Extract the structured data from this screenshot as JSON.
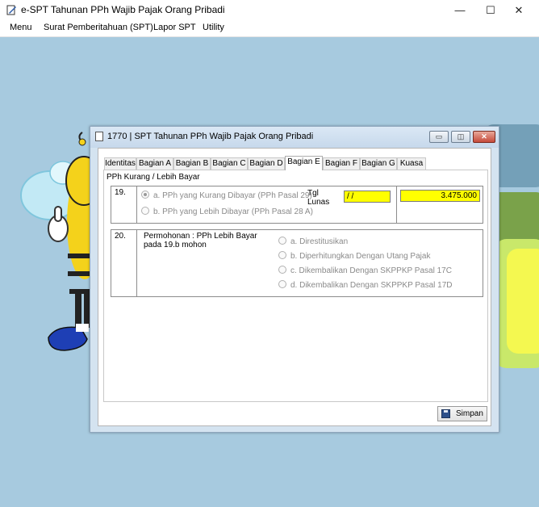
{
  "window": {
    "title": "e-SPT Tahunan PPh Wajib Pajak Orang Pribadi",
    "minimize_symbol": "—",
    "maximize_symbol": "☐",
    "close_symbol": "✕"
  },
  "menubar": {
    "items": [
      "Menu",
      "Surat Pemberitahuan (SPT)",
      "Lapor SPT",
      "Utility"
    ]
  },
  "dialog": {
    "title": "1770 | SPT Tahunan PPh Wajib Pajak Orang Pribadi",
    "minimize_symbol": "▭",
    "restore_symbol": "◫",
    "close_symbol": "✕",
    "tabs": [
      "Identitas",
      "Bagian A",
      "Bagian B",
      "Bagian C",
      "Bagian D",
      "Bagian E",
      "Bagian F",
      "Bagian G",
      "Kuasa"
    ],
    "active_tab": "Bagian E",
    "section_label": "PPh Kurang / Lebih Bayar",
    "row19": {
      "number": "19.",
      "option_a": "a. PPh yang Kurang Dibayar (PPh Pasal 29)",
      "option_b": "b. PPh yang Lebih Dibayar (PPh Pasal 28 A)",
      "selected": "a",
      "tgl_lunas_label": "Tgl Lunas",
      "tgl_lunas_value": " / /",
      "amount_value": "3.475.000"
    },
    "row20": {
      "number": "20.",
      "label": "Permohonan : PPh Lebih Bayar pada 19.b mohon",
      "options": [
        "a. Direstitusikan",
        "b. Diperhitungkan Dengan Utang Pajak",
        "c. Dikembalikan Dengan SKPPKP Pasal 17C",
        "d. Dikembalikan Dengan SKPPKP Pasal 17D"
      ]
    },
    "save_button": "Simpan"
  },
  "icons": {
    "app": "app-document-icon",
    "dialog": "document-icon",
    "save": "floppy-disk-icon"
  },
  "colors": {
    "desktop": "#a7cadf",
    "highlight_field": "#ffff00",
    "dialog_frame": "#d4e3f0"
  }
}
